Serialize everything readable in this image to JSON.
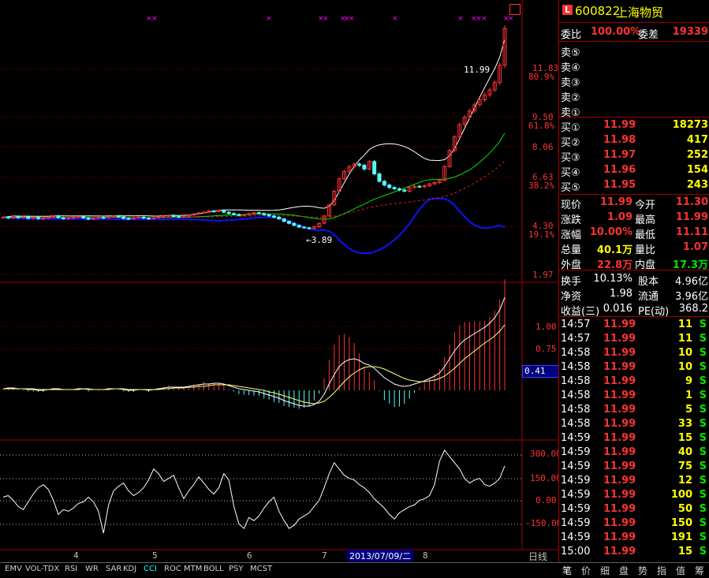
{
  "stock": {
    "code": "600822",
    "name": "上海物贸",
    "badge": "L"
  },
  "order_summary": {
    "weibi_label": "委比",
    "weibi_value": "100.00%",
    "weicha_label": "委差",
    "weicha_value": "19339"
  },
  "sell_book": [
    {
      "label": "卖⑤",
      "price": "",
      "volume": ""
    },
    {
      "label": "卖④",
      "price": "",
      "volume": ""
    },
    {
      "label": "卖③",
      "price": "",
      "volume": ""
    },
    {
      "label": "卖②",
      "price": "",
      "volume": ""
    },
    {
      "label": "卖①",
      "price": "",
      "volume": ""
    }
  ],
  "buy_book": [
    {
      "label": "买①",
      "price": "11.99",
      "volume": "18273"
    },
    {
      "label": "买②",
      "price": "11.98",
      "volume": "417"
    },
    {
      "label": "买③",
      "price": "11.97",
      "volume": "252"
    },
    {
      "label": "买④",
      "price": "11.96",
      "volume": "154"
    },
    {
      "label": "买⑤",
      "price": "11.95",
      "volume": "243"
    }
  ],
  "quote": [
    {
      "l1": "现价",
      "v1": "11.99",
      "c1": "red",
      "l2": "今开",
      "v2": "11.30",
      "c2": "red"
    },
    {
      "l1": "涨跌",
      "v1": "1.09",
      "c1": "red",
      "l2": "最高",
      "v2": "11.99",
      "c2": "red"
    },
    {
      "l1": "涨幅",
      "v1": "10.00%",
      "c1": "red",
      "l2": "最低",
      "v2": "11.11",
      "c2": "red"
    },
    {
      "l1": "总量",
      "v1": "40.1万",
      "c1": "yellow",
      "l2": "量比",
      "v2": "1.07",
      "c2": "red"
    },
    {
      "l1": "外盘",
      "v1": "22.8万",
      "c1": "red",
      "l2": "内盘",
      "v2": "17.3万",
      "c2": "green"
    }
  ],
  "fundamentals": [
    {
      "l1": "换手",
      "v1": "10.13%",
      "l2": "股本",
      "v2": "4.96亿"
    },
    {
      "l1": "净资",
      "v1": "1.98",
      "l2": "流通",
      "v2": "3.96亿"
    },
    {
      "l1": "收益(三)",
      "v1": "0.016",
      "l2": "PE(动)",
      "v2": "368.2"
    }
  ],
  "ticks": [
    {
      "time": "14:57",
      "price": "11.99",
      "vol": "11",
      "side": "S"
    },
    {
      "time": "14:57",
      "price": "11.99",
      "vol": "11",
      "side": "S"
    },
    {
      "time": "14:58",
      "price": "11.99",
      "vol": "10",
      "side": "S"
    },
    {
      "time": "14:58",
      "price": "11.99",
      "vol": "10",
      "side": "S"
    },
    {
      "time": "14:58",
      "price": "11.99",
      "vol": "9",
      "side": "S"
    },
    {
      "time": "14:58",
      "price": "11.99",
      "vol": "1",
      "side": "S"
    },
    {
      "time": "14:58",
      "price": "11.99",
      "vol": "5",
      "side": "S"
    },
    {
      "time": "14:58",
      "price": "11.99",
      "vol": "33",
      "side": "S"
    },
    {
      "time": "14:59",
      "price": "11.99",
      "vol": "15",
      "side": "S"
    },
    {
      "time": "14:59",
      "price": "11.99",
      "vol": "40",
      "side": "S"
    },
    {
      "time": "14:59",
      "price": "11.99",
      "vol": "75",
      "side": "S"
    },
    {
      "time": "14:59",
      "price": "11.99",
      "vol": "12",
      "side": "S"
    },
    {
      "time": "14:59",
      "price": "11.99",
      "vol": "100",
      "side": "S"
    },
    {
      "time": "14:59",
      "price": "11.99",
      "vol": "50",
      "side": "S"
    },
    {
      "time": "14:59",
      "price": "11.99",
      "vol": "150",
      "side": "S"
    },
    {
      "time": "14:59",
      "price": "11.99",
      "vol": "191",
      "side": "S"
    },
    {
      "time": "15:00",
      "price": "11.99",
      "vol": "15",
      "side": "S"
    }
  ],
  "price_axis": [
    {
      "label": "11.83",
      "sub": "80.9%"
    },
    {
      "label": "9.50",
      "sub": "61.8%"
    },
    {
      "label": "8.06",
      "sub": ""
    },
    {
      "label": "6.63",
      "sub": "38.2%"
    },
    {
      "label": "4.30",
      "sub": "19.1%"
    },
    {
      "label": "1.97",
      "sub": ""
    }
  ],
  "price_annotations": {
    "high": "11.99",
    "low": "3.89"
  },
  "macd_axis": [
    "1.00",
    "0.75"
  ],
  "macd_current": "0.41",
  "cci_axis": [
    "300.00",
    "150.00",
    "0.00",
    "-150.00"
  ],
  "date_axis": {
    "month_labels": [
      "4",
      "5",
      "6",
      "7",
      "8"
    ],
    "highlight_date": "2013/07/09/二",
    "period": "日线"
  },
  "indicator_tabs": [
    "EMV",
    "VOL-TDX",
    "RSI",
    "WR",
    "SAR",
    "KDJ",
    "CCI",
    "ROC",
    "MTM",
    "BOLL",
    "PSY",
    "MCST"
  ],
  "active_indicator": "CCI",
  "right_tabs": [
    "笔",
    "价",
    "细",
    "盘",
    "势",
    "指",
    "值",
    "筹"
  ],
  "active_right_tab": "笔",
  "colors": {
    "up": "#ff3232",
    "down": "#54ffff",
    "ma_white": "#ffffff",
    "ma_green": "#00e600",
    "boll_blue": "#1010ff",
    "boll_red": "#e02020",
    "grid": "#a00000"
  },
  "chart_data": {
    "type": "candlestick",
    "price_panel": {
      "ylim": [
        1.97,
        12.5
      ],
      "closes": [
        4.35,
        4.32,
        4.38,
        4.33,
        4.36,
        4.3,
        4.34,
        4.29,
        4.31,
        4.36,
        4.4,
        4.33,
        4.29,
        4.31,
        4.35,
        4.38,
        4.32,
        4.27,
        4.3,
        4.34,
        4.33,
        4.37,
        4.4,
        4.36,
        4.3,
        4.28,
        4.32,
        4.35,
        4.31,
        4.29,
        4.33,
        4.36,
        4.4,
        4.42,
        4.38,
        4.35,
        4.39,
        4.44,
        4.48,
        4.52,
        4.55,
        4.6,
        4.58,
        4.62,
        4.55,
        4.5,
        4.46,
        4.42,
        4.45,
        4.49,
        4.53,
        4.5,
        4.45,
        4.4,
        4.35,
        4.28,
        4.18,
        4.1,
        4.02,
        3.95,
        3.92,
        3.89,
        3.96,
        4.1,
        4.4,
        4.85,
        5.4,
        5.9,
        6.2,
        6.4,
        6.5,
        6.45,
        6.3,
        6.6,
        6.1,
        5.8,
        5.65,
        5.55,
        5.5,
        5.45,
        5.4,
        5.55,
        5.6,
        5.58,
        5.62,
        5.7,
        5.75,
        5.85,
        6.4,
        7.05,
        7.6,
        8.1,
        8.4,
        8.65,
        8.9,
        9.1,
        9.3,
        9.5,
        9.8,
        10.5,
        11.99
      ]
    },
    "macd_panel": {
      "ylim": [
        -0.45,
        1.25
      ],
      "dif": [
        0.02,
        0.03,
        0.03,
        0.02,
        0.02,
        0.01,
        0.01,
        0.0,
        0.0,
        0.01,
        0.02,
        0.02,
        0.01,
        0.01,
        0.01,
        0.02,
        0.02,
        0.01,
        0.01,
        0.01,
        0.01,
        0.02,
        0.02,
        0.02,
        0.01,
        0.0,
        0.0,
        0.01,
        0.01,
        0.0,
        0.01,
        0.02,
        0.03,
        0.04,
        0.04,
        0.04,
        0.04,
        0.05,
        0.06,
        0.07,
        0.08,
        0.08,
        0.09,
        0.09,
        0.08,
        0.06,
        0.04,
        0.02,
        0.01,
        0.0,
        -0.01,
        -0.02,
        -0.04,
        -0.06,
        -0.08,
        -0.1,
        -0.13,
        -0.15,
        -0.17,
        -0.19,
        -0.2,
        -0.2,
        -0.18,
        -0.14,
        -0.05,
        0.08,
        0.2,
        0.3,
        0.36,
        0.39,
        0.4,
        0.38,
        0.34,
        0.32,
        0.28,
        0.22,
        0.16,
        0.12,
        0.08,
        0.06,
        0.05,
        0.06,
        0.08,
        0.1,
        0.12,
        0.15,
        0.18,
        0.22,
        0.3,
        0.4,
        0.5,
        0.58,
        0.64,
        0.68,
        0.72,
        0.76,
        0.8,
        0.85,
        0.92,
        1.02,
        1.18
      ],
      "dea": [
        0.02,
        0.02,
        0.02,
        0.02,
        0.02,
        0.02,
        0.02,
        0.01,
        0.01,
        0.01,
        0.01,
        0.01,
        0.01,
        0.01,
        0.01,
        0.01,
        0.02,
        0.02,
        0.01,
        0.01,
        0.01,
        0.01,
        0.02,
        0.02,
        0.02,
        0.01,
        0.01,
        0.01,
        0.01,
        0.01,
        0.01,
        0.01,
        0.02,
        0.02,
        0.03,
        0.03,
        0.03,
        0.04,
        0.04,
        0.05,
        0.05,
        0.06,
        0.07,
        0.07,
        0.07,
        0.07,
        0.06,
        0.05,
        0.04,
        0.03,
        0.02,
        0.01,
        0.0,
        -0.02,
        -0.03,
        -0.05,
        -0.07,
        -0.09,
        -0.11,
        -0.13,
        -0.15,
        -0.16,
        -0.17,
        -0.16,
        -0.14,
        -0.09,
        -0.03,
        0.04,
        0.11,
        0.17,
        0.22,
        0.26,
        0.29,
        0.3,
        0.3,
        0.29,
        0.27,
        0.24,
        0.21,
        0.18,
        0.15,
        0.13,
        0.12,
        0.11,
        0.11,
        0.12,
        0.13,
        0.15,
        0.18,
        0.23,
        0.28,
        0.34,
        0.4,
        0.45,
        0.5,
        0.55,
        0.6,
        0.64,
        0.69,
        0.75,
        0.83
      ]
    },
    "cci_panel": {
      "ylim": [
        -300,
        330
      ],
      "values": [
        0,
        10,
        -20,
        -60,
        -80,
        -30,
        20,
        60,
        80,
        50,
        -20,
        -110,
        -80,
        -90,
        -70,
        -40,
        -30,
        0,
        -30,
        -90,
        -230,
        -50,
        40,
        70,
        90,
        40,
        10,
        30,
        60,
        110,
        180,
        150,
        100,
        120,
        140,
        60,
        -10,
        40,
        80,
        130,
        90,
        50,
        20,
        60,
        150,
        110,
        -60,
        -170,
        -200,
        -130,
        -150,
        -120,
        -70,
        -30,
        0,
        -90,
        -150,
        -200,
        -180,
        -140,
        -120,
        -100,
        -60,
        -20,
        60,
        150,
        220,
        180,
        140,
        120,
        110,
        80,
        60,
        30,
        -10,
        -40,
        -70,
        -110,
        -140,
        -100,
        -80,
        -60,
        -50,
        -20,
        -10,
        10,
        80,
        230,
        300,
        260,
        220,
        180,
        120,
        90,
        110,
        120,
        80,
        70,
        90,
        120,
        200
      ]
    },
    "dates": {
      "month_labels": [
        "4",
        "5",
        "6",
        "7",
        "8"
      ]
    }
  }
}
